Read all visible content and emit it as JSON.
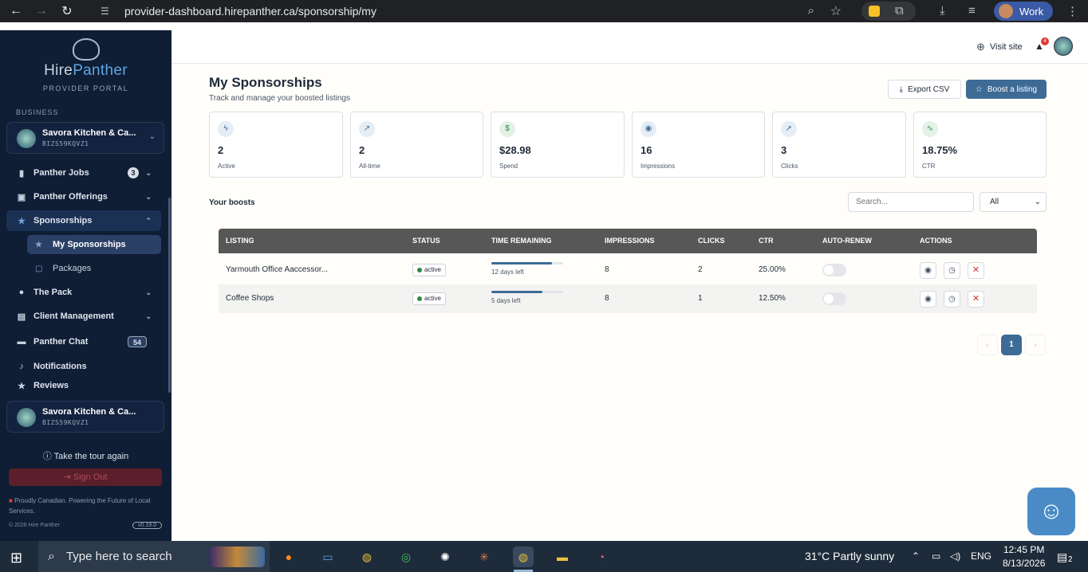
{
  "browser": {
    "url": "provider-dashboard.hirepanther.ca/sponsorship/my",
    "profile_label": "Work"
  },
  "sidebar": {
    "brand_name_a": "Hire",
    "brand_name_b": "Panther",
    "brand_subtitle": "PROVIDER PORTAL",
    "section_label": "BUSINESS",
    "business": {
      "name": "Savora Kitchen & Ca...",
      "id": "BIZS59KQVZ1"
    },
    "items": [
      {
        "label": "Panther Jobs",
        "badge": "3"
      },
      {
        "label": "Panther Offerings"
      },
      {
        "label": "Sponsorships"
      },
      {
        "label": "My Sponsorships"
      },
      {
        "label": "Packages"
      },
      {
        "label": "The Pack"
      },
      {
        "label": "Client Management"
      },
      {
        "label": "Panther Chat",
        "badge": "54"
      },
      {
        "label": "Notifications"
      },
      {
        "label": "Reviews"
      }
    ],
    "footer_business": {
      "name": "Savora Kitchen & Ca...",
      "id": "BIZS59KQVZ1"
    },
    "tour_label": "Take the tour again",
    "signout_label": "Sign Out",
    "proud_text": "Proudly Canadian. Powering the Future of Local Services.",
    "copyright": "© 2026 Hire Panther",
    "version": "v0.19.0"
  },
  "topbar": {
    "visit_site": "Visit site",
    "notif_count": "4"
  },
  "page": {
    "title": "My Sponsorships",
    "subtitle": "Track and manage your boosted listings",
    "export_label": "Export CSV",
    "boost_label": "Boost a listing"
  },
  "stats": [
    {
      "value": "2",
      "label": "Active",
      "icon": "zap-icon"
    },
    {
      "value": "2",
      "label": "All-time",
      "icon": "trending-up-icon"
    },
    {
      "value": "$28.98",
      "label": "Spend",
      "icon": "dollar-icon"
    },
    {
      "value": "16",
      "label": "Impressions",
      "icon": "eye-icon"
    },
    {
      "value": "3",
      "label": "Clicks",
      "icon": "cursor-icon"
    },
    {
      "value": "18.75%",
      "label": "CTR",
      "icon": "activity-icon"
    }
  ],
  "boosts": {
    "heading": "Your boosts",
    "search_placeholder": "Search...",
    "filter_value": "All",
    "columns": [
      "LISTING",
      "STATUS",
      "TIME REMAINING",
      "IMPRESSIONS",
      "CLICKS",
      "CTR",
      "AUTO-RENEW",
      "ACTIONS"
    ],
    "rows": [
      {
        "listing": "Yarmouth Office Aaccessor...",
        "status": "active",
        "time_left": "12 days left",
        "time_fraction": 0.84,
        "impressions": "8",
        "clicks": "2",
        "ctr": "25.00%",
        "auto_renew": false
      },
      {
        "listing": "Coffee Shops",
        "status": "active",
        "time_left": "5 days left",
        "time_fraction": 0.71,
        "impressions": "8",
        "clicks": "1",
        "ctr": "12.50%",
        "auto_renew": false
      }
    ],
    "pagination": {
      "prev": "‹",
      "page": "1",
      "next": "›"
    }
  },
  "taskbar": {
    "search_placeholder": "Type here to search",
    "weather": "31°C  Partly sunny",
    "lang": "ENG",
    "time": "12:45 PM",
    "date": "8/13/2026",
    "notif_count": "2"
  }
}
